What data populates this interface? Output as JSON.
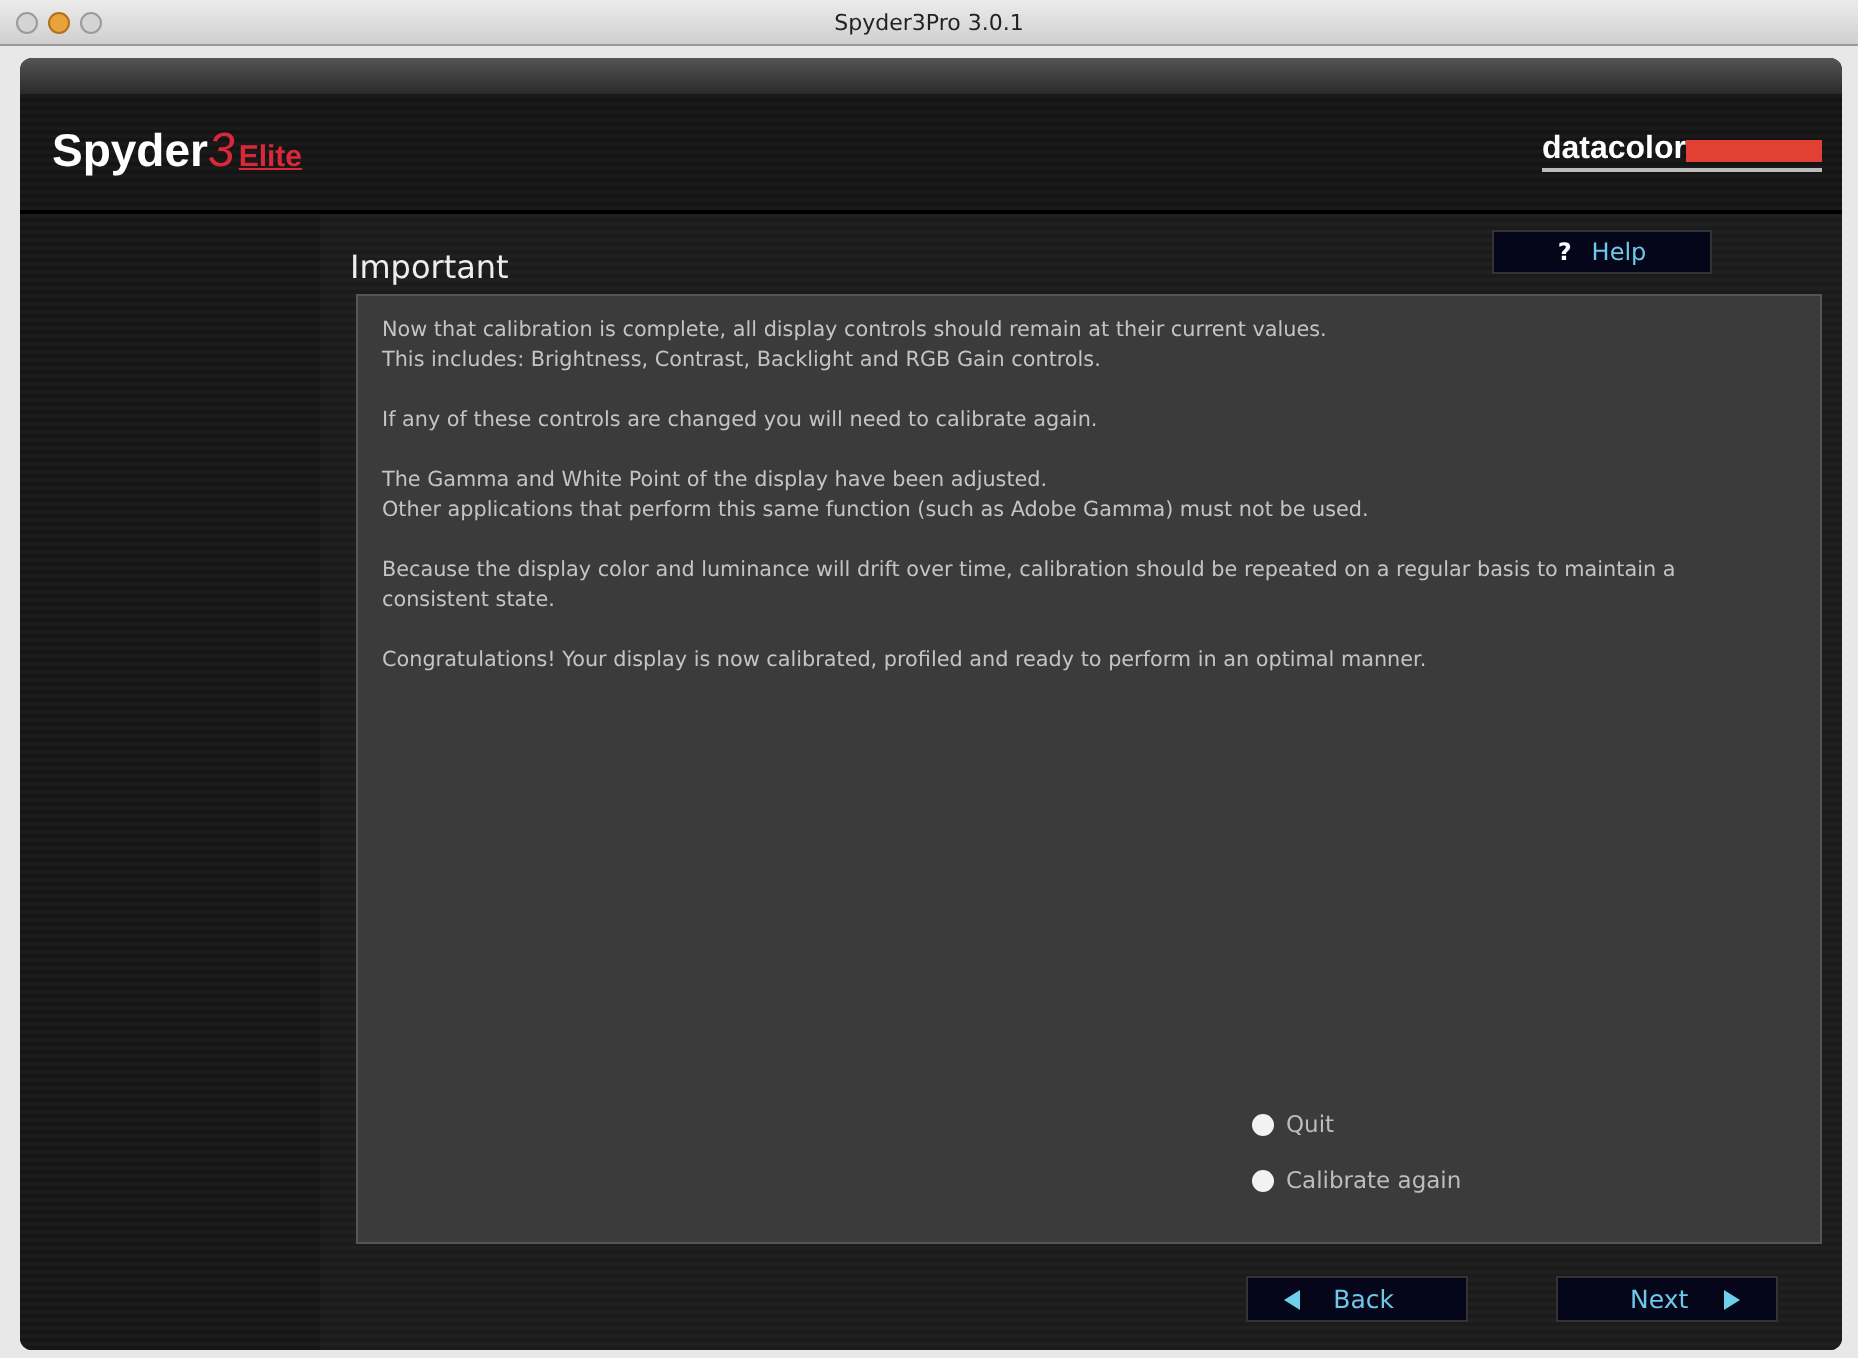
{
  "window": {
    "title": "Spyder3Pro 3.0.1"
  },
  "logo": {
    "name": "Spyder",
    "number": "3",
    "edition": "Elite"
  },
  "brand": "datacolor",
  "page": {
    "title": "Important",
    "help": {
      "icon": "?",
      "label": "Help"
    }
  },
  "paragraphs": [
    [
      "Now that calibration is complete, all display controls should remain at their current values.",
      "This includes: Brightness, Contrast, Backlight and RGB Gain controls."
    ],
    [
      "If any of these controls are changed you will need to calibrate again."
    ],
    [
      "The Gamma and White Point of the display have been adjusted.",
      "Other applications that perform this same function (such as Adobe Gamma) must not be used."
    ],
    [
      "Because the display color and luminance will drift over time, calibration should be repeated on a regular basis to maintain a consistent state."
    ],
    [
      "Congratulations! Your display is now calibrated, profiled and ready to perform in an optimal manner."
    ]
  ],
  "options": [
    {
      "label": "Quit",
      "selected": false
    },
    {
      "label": "Calibrate again",
      "selected": false
    }
  ],
  "buttons": [
    {
      "label": "Back",
      "kind": "back"
    },
    {
      "label": "Next",
      "kind": "next"
    }
  ]
}
